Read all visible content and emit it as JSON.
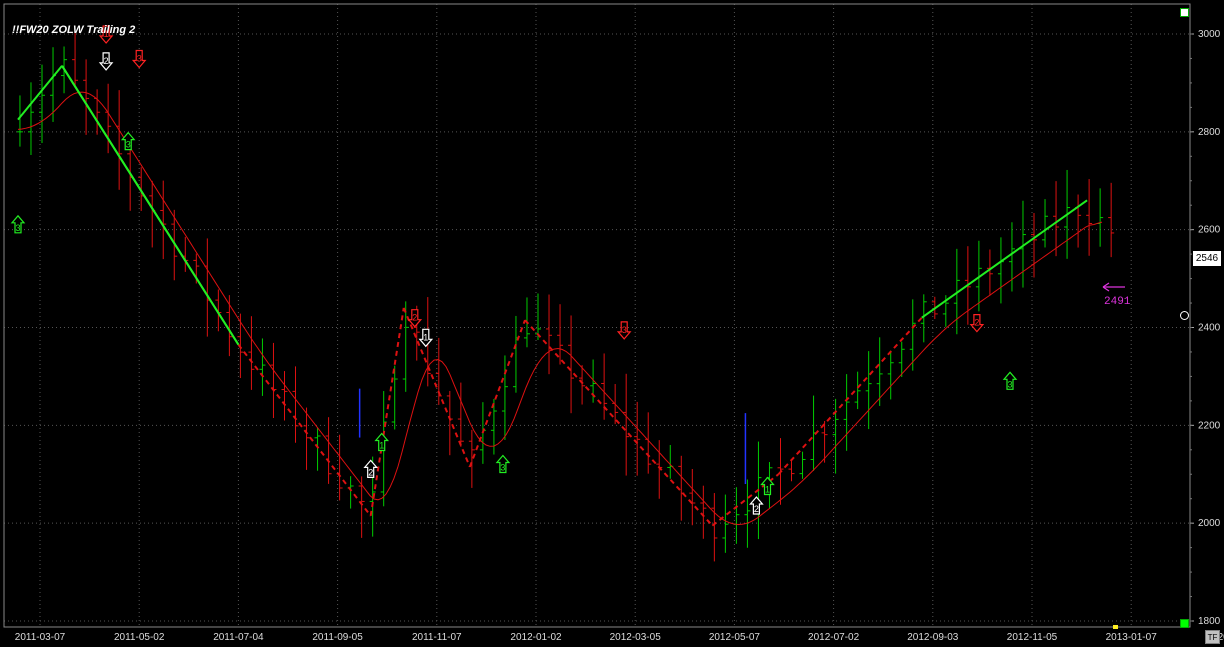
{
  "title": "!!FW20 ZOLW Trailing 2",
  "last_price": "2546",
  "annotation_value": "2491",
  "tf_label": "TF",
  "colors": {
    "background": "#000000",
    "up_bar": "#00cc00",
    "down_bar": "#dd1111",
    "zigzag": "#22ee22",
    "moving_average": "#dd1111",
    "annotation": "#dd33dd",
    "grid": "#555555"
  },
  "chart_data": {
    "type": "bar",
    "ylim": [
      1800,
      3000
    ],
    "yticks": [
      "3000",
      "2800",
      "2600",
      "2400",
      "2200",
      "2000",
      "1800"
    ],
    "xticks": [
      "2011-03-07",
      "2011-05-02",
      "2011-07-04",
      "2011-09-05",
      "2011-11-07",
      "2012-01-02",
      "2012-03-05",
      "2012-05-07",
      "2012-07-02",
      "2012-09-03",
      "2012-11-05",
      "2013-01-07",
      "2013-"
    ],
    "zigzag": [
      {
        "date": "2011-02-21",
        "value": 2825
      },
      {
        "date": "2011-03-21",
        "value": 2935
      },
      {
        "date": "2011-07-11",
        "value": 2365
      },
      {
        "date": "2011-10-03",
        "value": 2015
      },
      {
        "date": "2011-10-24",
        "value": 2440
      },
      {
        "date": "2011-12-05",
        "value": 2115
      },
      {
        "date": "2012-01-09",
        "value": 2415
      },
      {
        "date": "2012-05-07",
        "value": 1995
      },
      {
        "date": "2012-06-18",
        "value": 2100
      },
      {
        "date": "2012-09-17",
        "value": 2420
      },
      {
        "date": "2012-12-31",
        "value": 2660
      }
    ],
    "signals": [
      {
        "label": "3",
        "dir": "up",
        "color": "green",
        "date": "2011-02-21",
        "value": 2610
      },
      {
        "label": "1",
        "dir": "down",
        "color": "red",
        "date": "2011-04-18",
        "value": 3000
      },
      {
        "label": "2",
        "dir": "down",
        "color": "white",
        "date": "2011-04-18",
        "value": 2945
      },
      {
        "label": "3",
        "dir": "down",
        "color": "red",
        "date": "2011-05-09",
        "value": 2950
      },
      {
        "label": "3",
        "dir": "up",
        "color": "green",
        "date": "2011-05-02",
        "value": 2780
      },
      {
        "label": "2",
        "dir": "up",
        "color": "white",
        "date": "2011-10-03",
        "value": 2110
      },
      {
        "label": "1",
        "dir": "up",
        "color": "green",
        "date": "2011-10-10",
        "value": 2165
      },
      {
        "label": "2",
        "dir": "down",
        "color": "red",
        "date": "2011-10-31",
        "value": 2420
      },
      {
        "label": "1",
        "dir": "down",
        "color": "white",
        "date": "2011-11-07",
        "value": 2380
      },
      {
        "label": "3",
        "dir": "up",
        "color": "green",
        "date": "2011-12-26",
        "value": 2120
      },
      {
        "label": "3",
        "dir": "down",
        "color": "red",
        "date": "2012-03-12",
        "value": 2395
      },
      {
        "label": "2",
        "dir": "up",
        "color": "white",
        "date": "2012-06-04",
        "value": 2035
      },
      {
        "label": "1",
        "dir": "up",
        "color": "green",
        "date": "2012-06-11",
        "value": 2075
      },
      {
        "label": "2",
        "dir": "down",
        "color": "red",
        "date": "2012-10-22",
        "value": 2410
      },
      {
        "label": "3",
        "dir": "up",
        "color": "green",
        "date": "2012-11-12",
        "value": 2290
      }
    ]
  }
}
